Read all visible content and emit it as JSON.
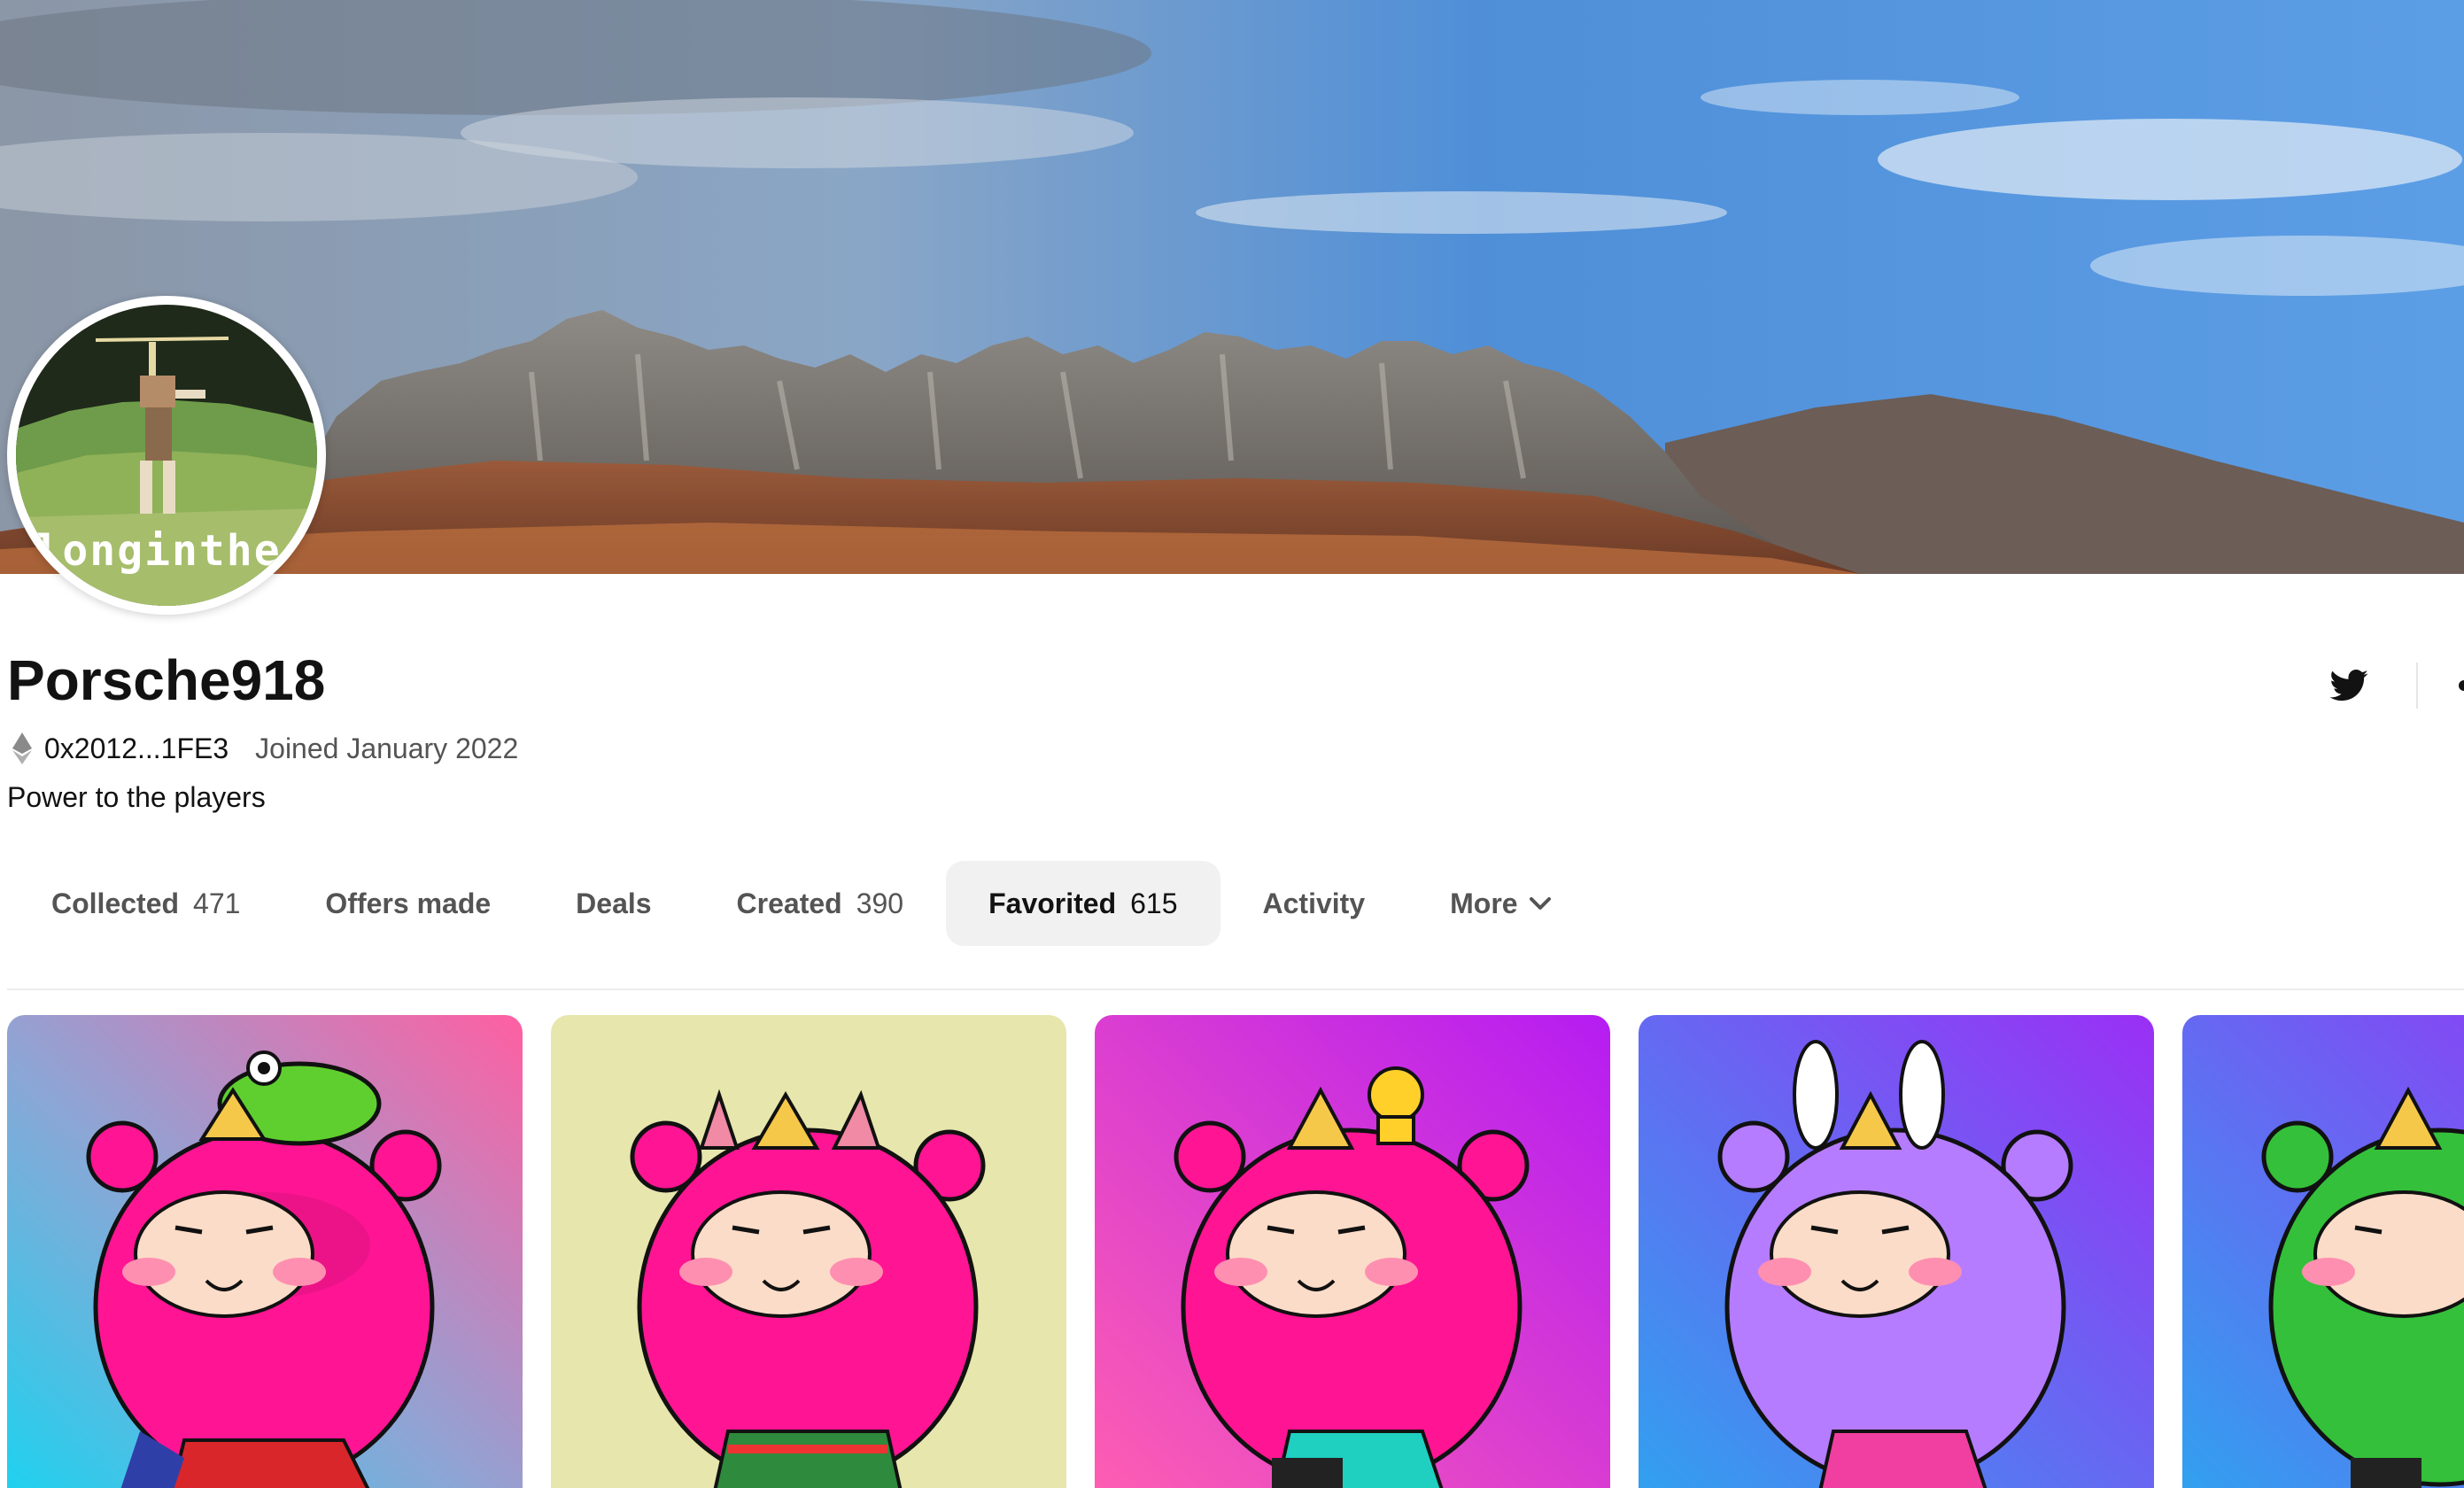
{
  "profile": {
    "username": "Porsche918",
    "address": "0x2012...1FE3",
    "joined": "Joined January 2022",
    "bio": "Power to the players",
    "avatar_text": "longinthec"
  },
  "tabs": [
    {
      "label": "Collected",
      "count": "471"
    },
    {
      "label": "Offers made",
      "count": ""
    },
    {
      "label": "Deals",
      "count": ""
    },
    {
      "label": "Created",
      "count": "390"
    },
    {
      "label": "Favorited",
      "count": "615"
    },
    {
      "label": "Activity",
      "count": ""
    },
    {
      "label": "More",
      "count": ""
    }
  ],
  "active_tab": "Favorited",
  "icons": {
    "eth": "ethereum-icon",
    "twitter": "twitter-icon",
    "more_tab": "chevron-down-icon"
  },
  "colors": {
    "active_tab_bg": "#f1f1f1",
    "text_primary": "#121212",
    "text_secondary": "#545454"
  },
  "cards": [
    {
      "theme": "pink bear with frog",
      "body": "#ff1493"
    },
    {
      "theme": "pink bear with horns",
      "body": "#ff1493"
    },
    {
      "theme": "pink bear with yellow bear",
      "body": "#ff1493"
    },
    {
      "theme": "purple bear with bunny ears",
      "body": "#b57cff"
    },
    {
      "theme": "green bear",
      "body": "#34c03a"
    }
  ]
}
